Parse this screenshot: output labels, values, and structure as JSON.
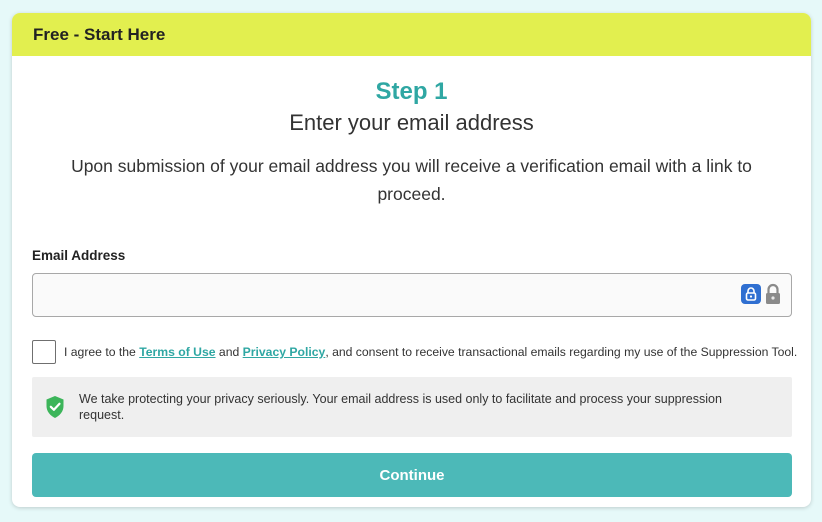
{
  "header": {
    "title": "Free - Start Here"
  },
  "step": {
    "label": "Step 1",
    "subtitle": "Enter your email address",
    "description": "Upon submission of your email address you will receive a verification email with a link to proceed."
  },
  "form": {
    "email_label": "Email Address",
    "email_value": "",
    "agree": {
      "prefix": "I agree to the ",
      "terms_link": "Terms of Use",
      "and": " and ",
      "privacy_link": "Privacy Policy",
      "suffix": ", and consent to receive transactional emails regarding my use of the Suppression Tool."
    },
    "privacy_note": "We take protecting your privacy seriously. Your email address is used only to facilitate and process your suppression request.",
    "continue_label": "Continue"
  },
  "icons": {
    "password_manager": "password-manager-icon",
    "lock": "lock-icon",
    "shield": "shield-check-icon"
  },
  "colors": {
    "header_bg": "#e2ef4f",
    "accent": "#2fa7a3",
    "button_bg": "#4cb9b8",
    "page_bg": "#e6f9f9",
    "shield": "#3cb55a"
  }
}
